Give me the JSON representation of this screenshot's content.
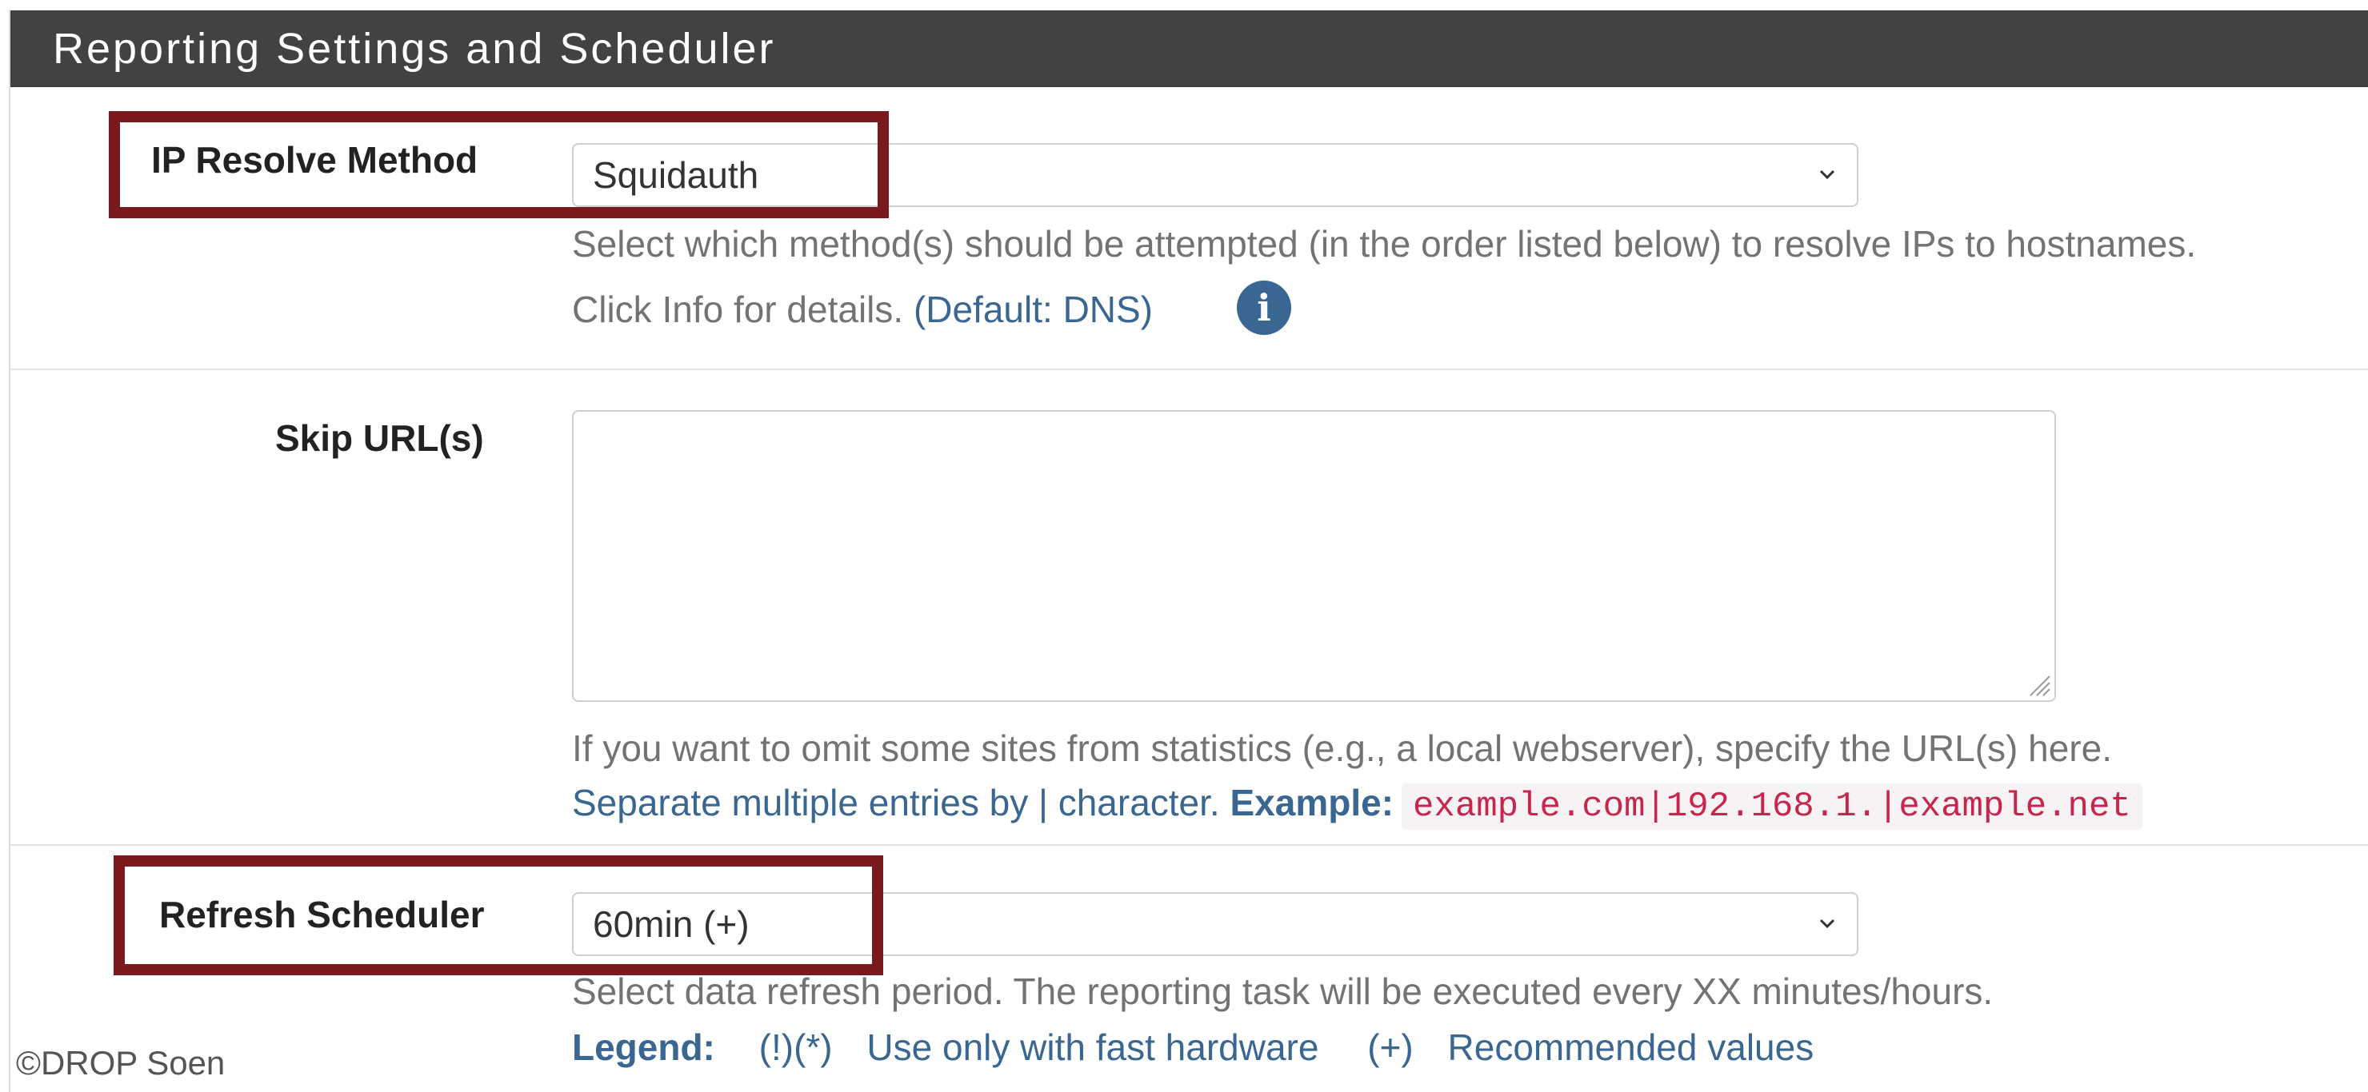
{
  "panel": {
    "title": "Reporting Settings and Scheduler"
  },
  "ip_resolve": {
    "label": "IP Resolve Method",
    "selected": "Squidauth",
    "help_line1": "Select which method(s) should be attempted (in the order listed below) to resolve IPs to hostnames.",
    "help_line2_prefix": "Click Info for details. ",
    "help_line2_default": "(Default: DNS)",
    "info_icon": "info-circle-icon"
  },
  "skip_urls": {
    "label": "Skip URL(s)",
    "value": "",
    "help_line1": "If you want to omit some sites from statistics (e.g., a local webserver), specify the URL(s) here.",
    "help_line2_prefix": "Separate multiple entries by | character. ",
    "help_line2_example_label": "Example:",
    "help_line2_example_code": "example.com|192.168.1.|example.net"
  },
  "refresh_scheduler": {
    "label": "Refresh Scheduler",
    "selected": "60min (+)",
    "help_line1": "Select data refresh period. The reporting task will be executed every XX minutes/hours.",
    "legend_label": "Legend:",
    "legend_item1_symbol": "(!)(*)",
    "legend_item1_text": "Use only with fast hardware",
    "legend_item2_symbol": "(+)",
    "legend_item2_text": "Recommended values"
  },
  "highlight_color": "#7b1a1e",
  "watermark": "©DROP Soen"
}
